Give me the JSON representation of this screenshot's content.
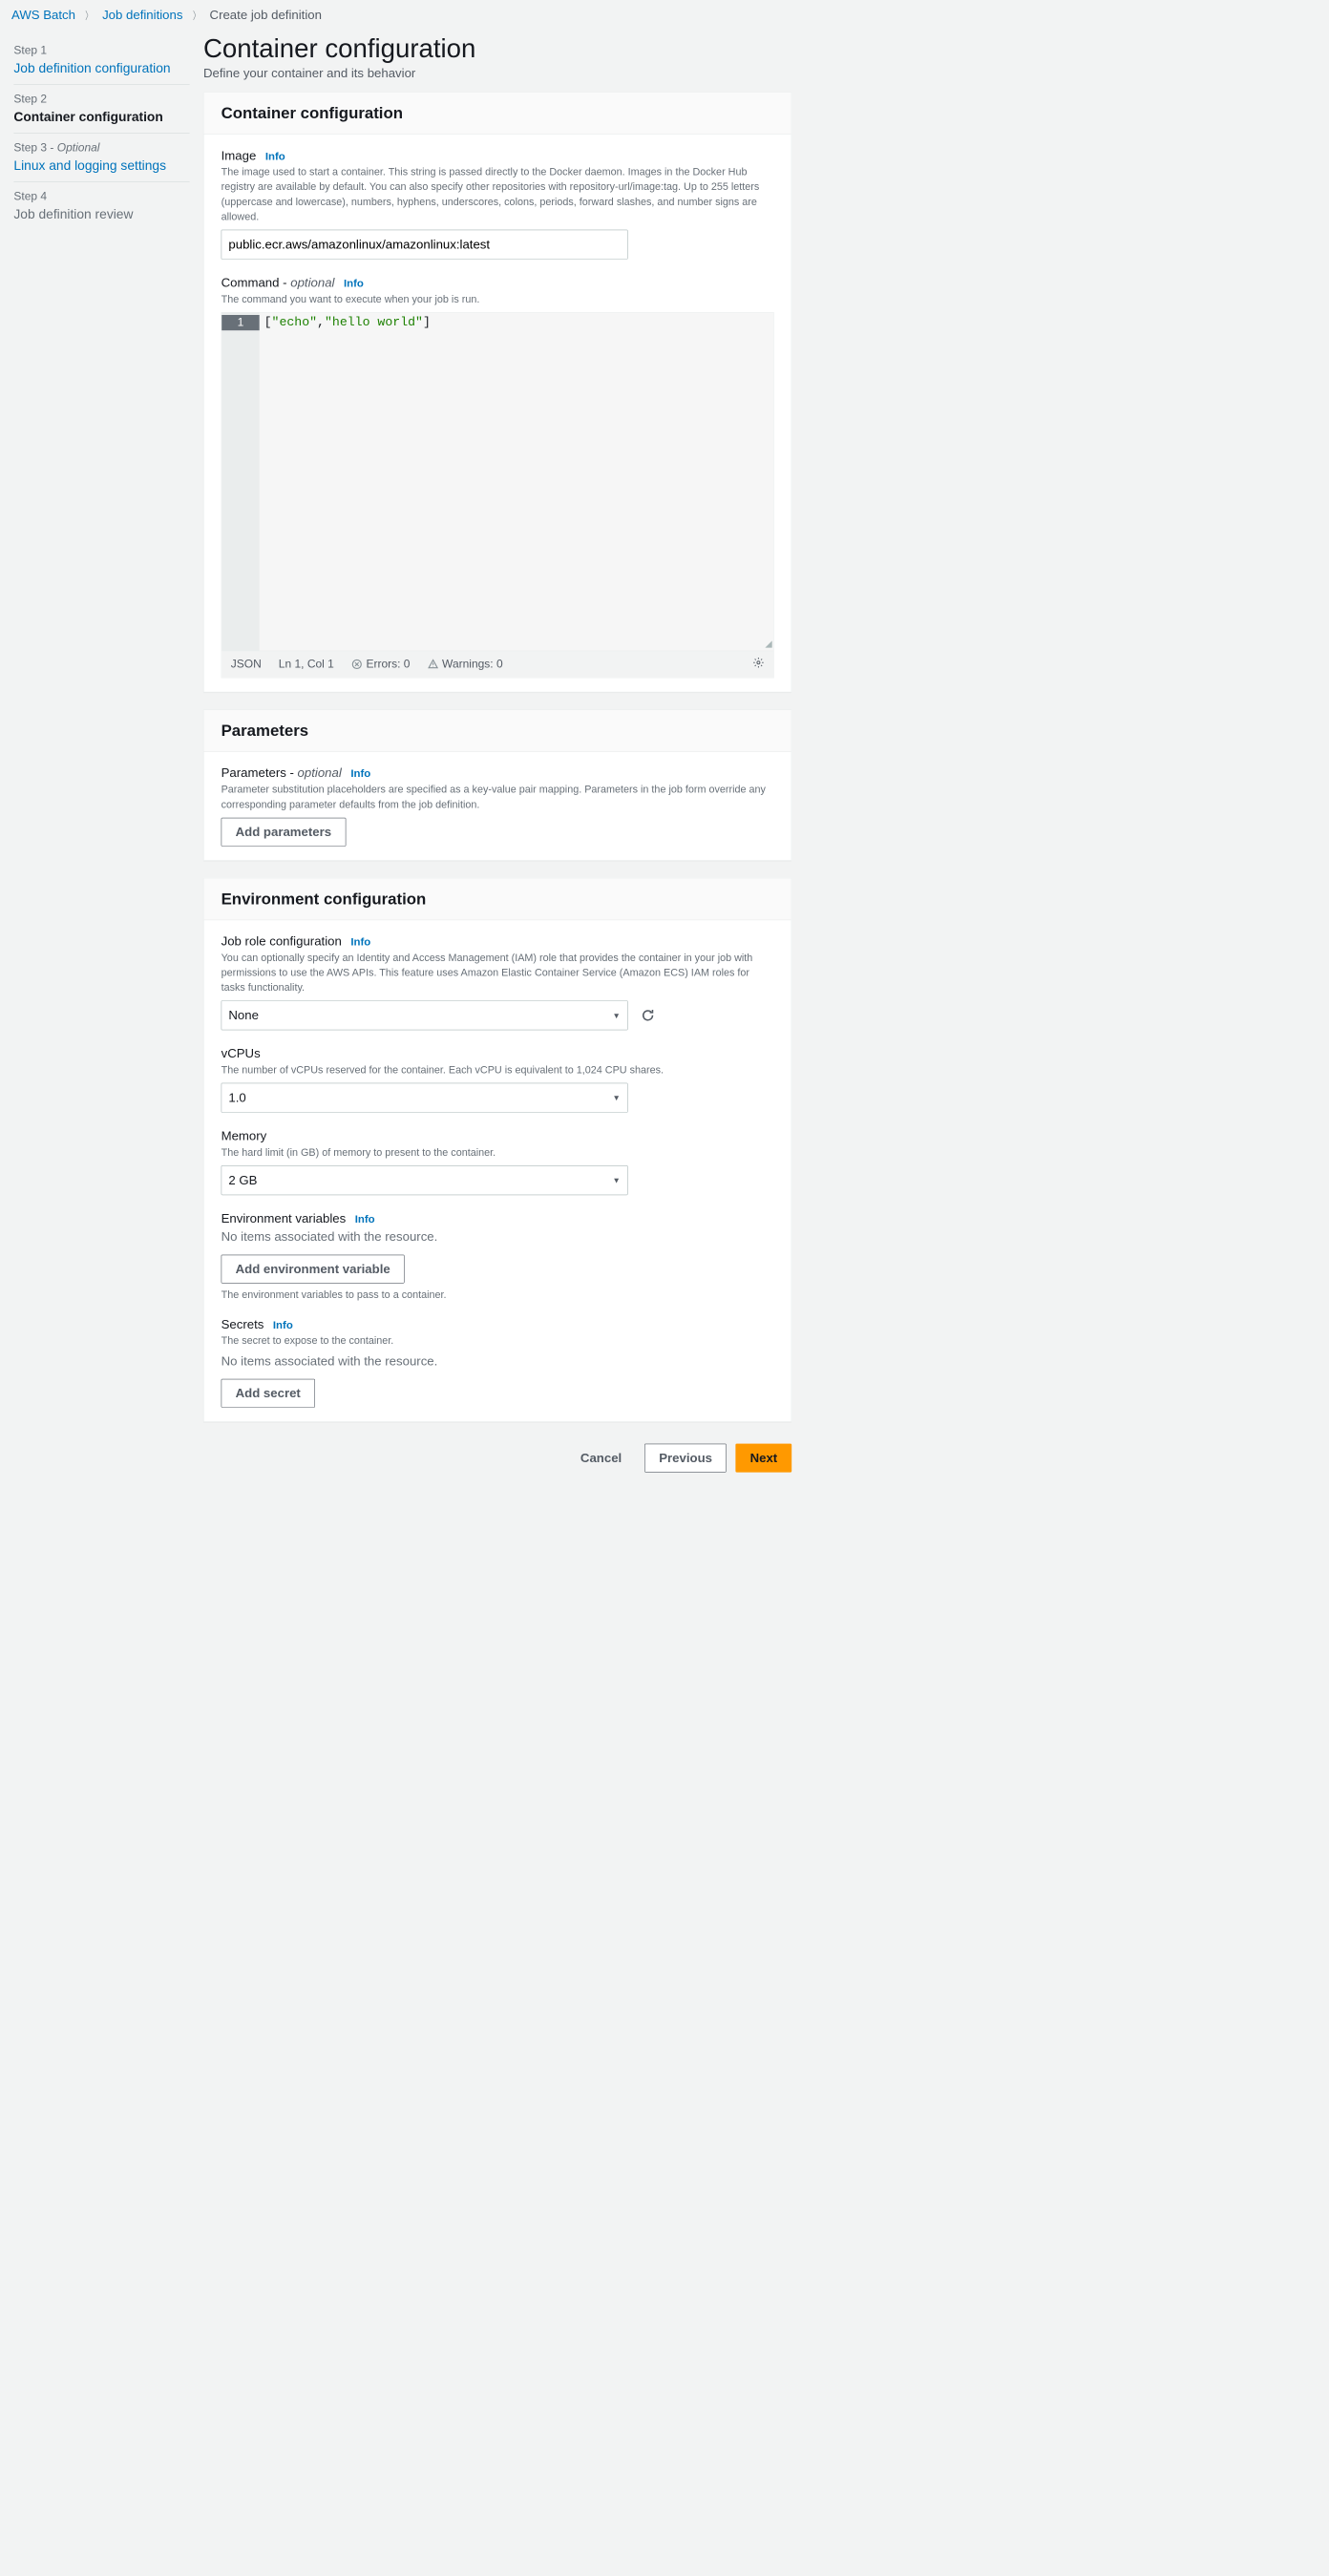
{
  "breadcrumb": {
    "items": [
      "AWS Batch",
      "Job definitions"
    ],
    "current": "Create job definition"
  },
  "sidebar": {
    "steps": [
      {
        "num": "Step 1",
        "title": "Job definition configuration",
        "link": true
      },
      {
        "num": "Step 2",
        "title": "Container configuration",
        "active": true
      },
      {
        "num": "Step 3 - ",
        "opt": "Optional",
        "title": "Linux and logging settings",
        "link": true
      },
      {
        "num": "Step 4",
        "title": "Job definition review",
        "plain": true
      }
    ]
  },
  "page": {
    "title": "Container configuration",
    "subtitle": "Define your container and its behavior"
  },
  "container": {
    "header": "Container configuration",
    "image": {
      "label": "Image",
      "info": "Info",
      "desc": "The image used to start a container. This string is passed directly to the Docker daemon. Images in the Docker Hub registry are available by default. You can also specify other repositories with repository-url/image:tag. Up to 255 letters (uppercase and lowercase), numbers, hyphens, underscores, colons, periods, forward slashes, and number signs are allowed.",
      "value": "public.ecr.aws/amazonlinux/amazonlinux:latest"
    },
    "command": {
      "label": "Command - ",
      "opt": "optional",
      "info": "Info",
      "desc": "The command you want to execute when your job is run.",
      "line_num": "1",
      "code_parts": {
        "open": "[",
        "s1": "\"echo\"",
        "comma": ",",
        "s2": "\"hello world\"",
        "close": "]"
      },
      "status": {
        "lang": "JSON",
        "pos": "Ln 1, Col 1",
        "errors": "Errors: 0",
        "warnings": "Warnings: 0"
      }
    }
  },
  "parameters": {
    "header": "Parameters",
    "label": "Parameters - ",
    "opt": "optional",
    "info": "Info",
    "desc": "Parameter substitution placeholders are specified as a key-value pair mapping. Parameters in the job form override any corresponding parameter defaults from the job definition.",
    "add": "Add parameters"
  },
  "env": {
    "header": "Environment configuration",
    "role": {
      "label": "Job role configuration",
      "info": "Info",
      "desc": "You can optionally specify an Identity and Access Management (IAM) role that provides the container in your job with permissions to use the AWS APIs. This feature uses Amazon Elastic Container Service (Amazon ECS) IAM roles for tasks functionality.",
      "value": "None"
    },
    "vcpus": {
      "label": "vCPUs",
      "desc": "The number of vCPUs reserved for the container. Each vCPU is equivalent to 1,024 CPU shares.",
      "value": "1.0"
    },
    "memory": {
      "label": "Memory",
      "desc": "The hard limit (in GB) of memory to present to the container.",
      "value": "2 GB"
    },
    "envvars": {
      "label": "Environment variables",
      "info": "Info",
      "empty": "No items associated with the resource.",
      "add": "Add environment variable",
      "note": "The environment variables to pass to a container."
    },
    "secrets": {
      "label": "Secrets",
      "info": "Info",
      "desc": "The secret to expose to the container.",
      "empty": "No items associated with the resource.",
      "add": "Add secret"
    }
  },
  "footer": {
    "cancel": "Cancel",
    "prev": "Previous",
    "next": "Next"
  }
}
